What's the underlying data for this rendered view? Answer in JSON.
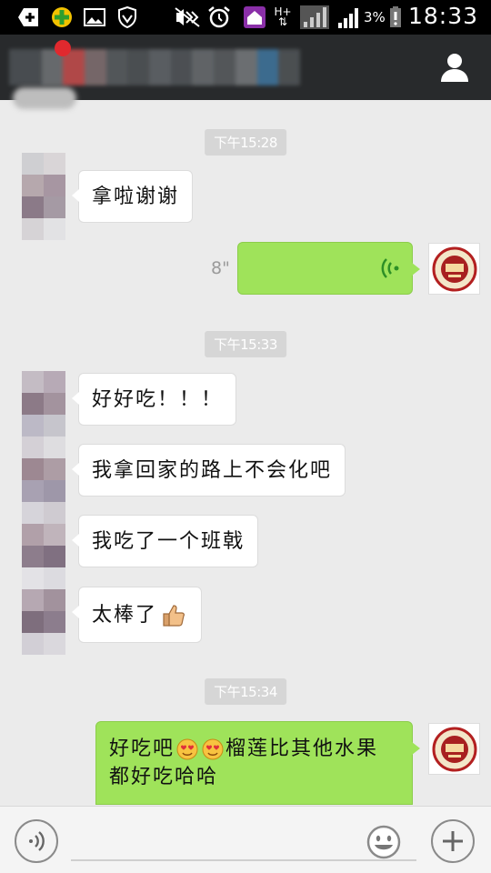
{
  "status_bar": {
    "time": "18:33",
    "battery_percent": "3%",
    "network_label": "H+",
    "icons": [
      "add-icon",
      "security-app-icon",
      "gallery-icon",
      "shield-icon",
      "mute-icon",
      "alarm-icon",
      "home-icon",
      "data-arrows-icon",
      "signal-bars-icon",
      "battery-icon"
    ]
  },
  "title_bar": {
    "chat_title": "",
    "profile_icon": "person-icon"
  },
  "messages": [
    {
      "type": "timestamp",
      "text": "下午15:28"
    },
    {
      "type": "incoming",
      "text": "拿啦谢谢"
    },
    {
      "type": "voice",
      "duration": "8\"",
      "icon": "voice-wave-icon"
    },
    {
      "type": "timestamp",
      "text": "下午15:33"
    },
    {
      "type": "incoming",
      "text": "好好吃！！！"
    },
    {
      "type": "incoming",
      "text": "我拿回家的路上不会化吧"
    },
    {
      "type": "incoming",
      "text": "我吃了一个班戟"
    },
    {
      "type": "incoming",
      "text": "太棒了",
      "emoji": "thumbs-up-icon"
    },
    {
      "type": "timestamp",
      "text": "下午15:34"
    },
    {
      "type": "outgoing",
      "text_part1": "好吃吧",
      "text_part2": "榴莲比其他水果",
      "text_line2": "都好吃哈哈",
      "emoji": "heart-eyes-icon"
    }
  ],
  "input_bar": {
    "voice_button_icon": "voice-input-icon",
    "emoji_button_icon": "smiley-icon",
    "more_button_icon": "plus-icon",
    "input_value": ""
  },
  "colors": {
    "outgoing_bubble": "#9fe35a",
    "incoming_bubble": "#ffffff",
    "title_bar": "#282a2c",
    "background": "#ebebeb"
  }
}
